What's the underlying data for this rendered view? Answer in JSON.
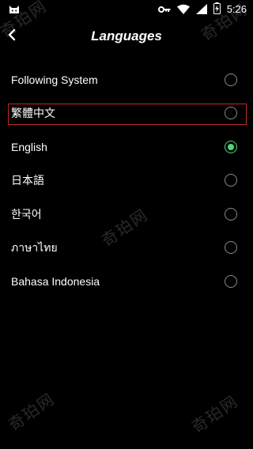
{
  "status_bar": {
    "time": "5:26",
    "icons": [
      "app-cat-icon",
      "key-icon",
      "wifi-icon",
      "signal-icon",
      "battery-charging-icon"
    ]
  },
  "header": {
    "back_icon": "chevron-left-icon",
    "title": "Languages"
  },
  "languages": [
    {
      "label": "Following System",
      "selected": false
    },
    {
      "label": "繁體中文",
      "selected": false,
      "highlighted": true
    },
    {
      "label": "English",
      "selected": true
    },
    {
      "label": "日本語",
      "selected": false
    },
    {
      "label": "한국어",
      "selected": false
    },
    {
      "label": "ภาษาไทย",
      "selected": false
    },
    {
      "label": "Bahasa Indonesia",
      "selected": false
    }
  ],
  "watermark": {
    "text": "奇珀网"
  },
  "colors": {
    "background": "#000000",
    "text": "#ffffff",
    "radio_border": "#8a8a8a",
    "radio_selected": "#4ed778",
    "highlight_border": "#c2262b"
  }
}
